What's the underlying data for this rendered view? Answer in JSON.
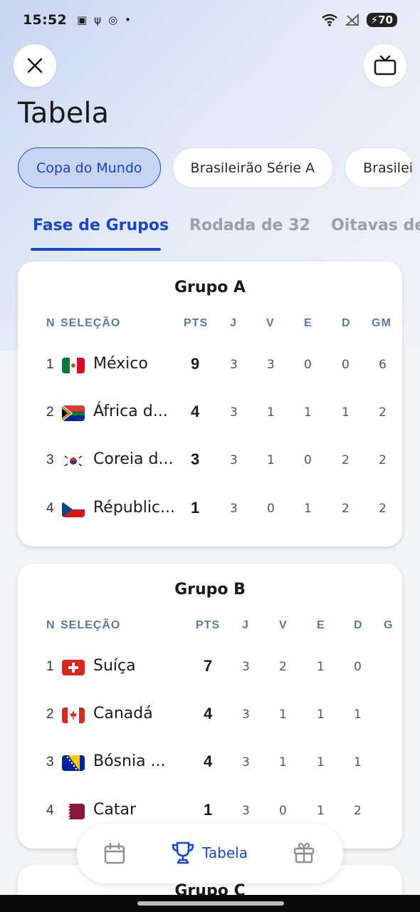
{
  "status_bar": {
    "time": "15:52",
    "battery": "70"
  },
  "page": {
    "title": "Tabela"
  },
  "competitions": [
    {
      "label": "Copa do Mundo",
      "active": true
    },
    {
      "label": "Brasileirão Série A",
      "active": false
    },
    {
      "label": "Brasilei",
      "active": false
    }
  ],
  "stages": [
    {
      "label": "Fase de Grupos",
      "active": true
    },
    {
      "label": "Rodada de 32",
      "active": false
    },
    {
      "label": "Oitavas de",
      "active": false
    }
  ],
  "groups": [
    {
      "title": "Grupo A",
      "headers": {
        "n": "N",
        "team": "SELEÇÃO",
        "pts": "PTS",
        "j": "J",
        "v": "V",
        "e": "E",
        "d": "D",
        "gm": "GM"
      },
      "rows": [
        {
          "n": "1",
          "name": "México",
          "pts": "9",
          "j": "3",
          "v": "3",
          "e": "0",
          "d": "0",
          "gm": "6",
          "flag": "mexico"
        },
        {
          "n": "2",
          "name": "África d...",
          "pts": "4",
          "j": "3",
          "v": "1",
          "e": "1",
          "d": "1",
          "gm": "2",
          "flag": "south-africa"
        },
        {
          "n": "3",
          "name": "Coreia d...",
          "pts": "3",
          "j": "3",
          "v": "1",
          "e": "0",
          "d": "2",
          "gm": "2",
          "flag": "south-korea"
        },
        {
          "n": "4",
          "name": "Républic...",
          "pts": "1",
          "j": "3",
          "v": "0",
          "e": "1",
          "d": "2",
          "gm": "2",
          "flag": "czech-republic"
        }
      ]
    },
    {
      "title": "Grupo B",
      "headers": {
        "n": "N",
        "team": "SELEÇÃO",
        "pts": "PTS",
        "j": "J",
        "v": "V",
        "e": "E",
        "d": "D",
        "gm": "G"
      },
      "rows": [
        {
          "n": "1",
          "name": "Suíça",
          "pts": "7",
          "j": "3",
          "v": "2",
          "e": "1",
          "d": "0",
          "flag": "switzerland"
        },
        {
          "n": "2",
          "name": "Canadá",
          "pts": "4",
          "j": "3",
          "v": "1",
          "e": "1",
          "d": "1",
          "flag": "canada"
        },
        {
          "n": "3",
          "name": "Bósnia ...",
          "pts": "4",
          "j": "3",
          "v": "1",
          "e": "1",
          "d": "1",
          "flag": "bosnia"
        },
        {
          "n": "4",
          "name": "Catar",
          "pts": "1",
          "j": "3",
          "v": "0",
          "e": "1",
          "d": "2",
          "flag": "qatar"
        }
      ]
    },
    {
      "title": "Grupo C"
    }
  ],
  "bottom_nav": {
    "active_label": "Tabela",
    "icons": [
      "calendar-icon",
      "trophy-icon",
      "gift-icon"
    ]
  },
  "colors": {
    "accent": "#1a47cc",
    "chip_active_bg": "#c7d4f4"
  }
}
